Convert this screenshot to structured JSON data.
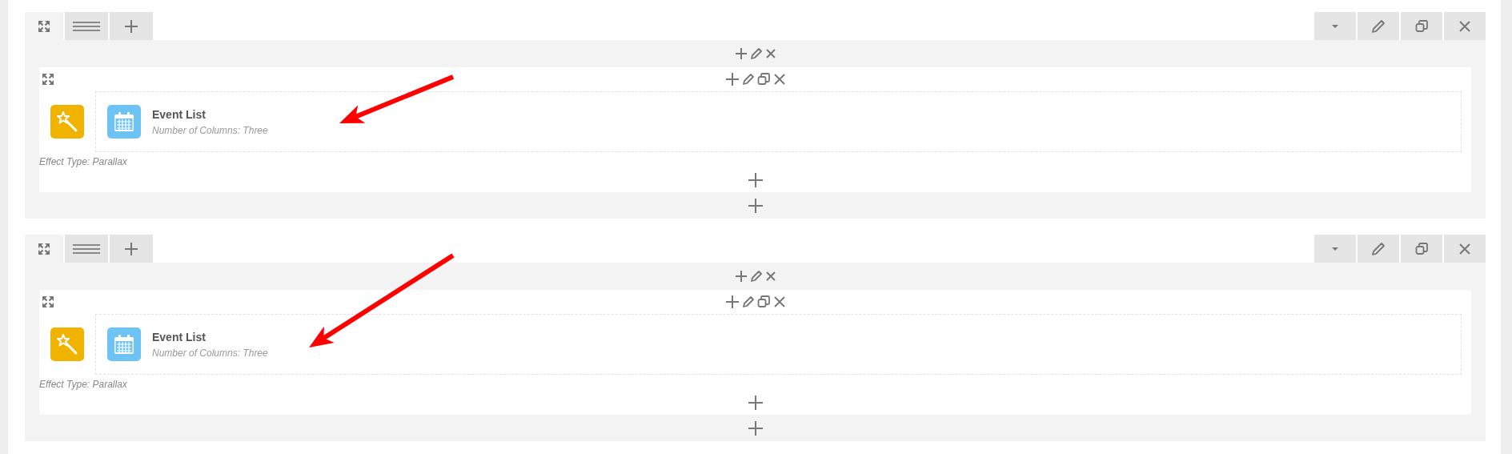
{
  "sections": [
    {
      "element": {
        "title": "Event List",
        "subtitle": "Number of Columns: Three"
      },
      "effect": "Effect Type: Parallax",
      "arrow": true
    },
    {
      "element": {
        "title": "Event List",
        "subtitle": "Number of Columns: Three"
      },
      "effect": "Effect Type: Parallax",
      "arrow": true
    }
  ]
}
